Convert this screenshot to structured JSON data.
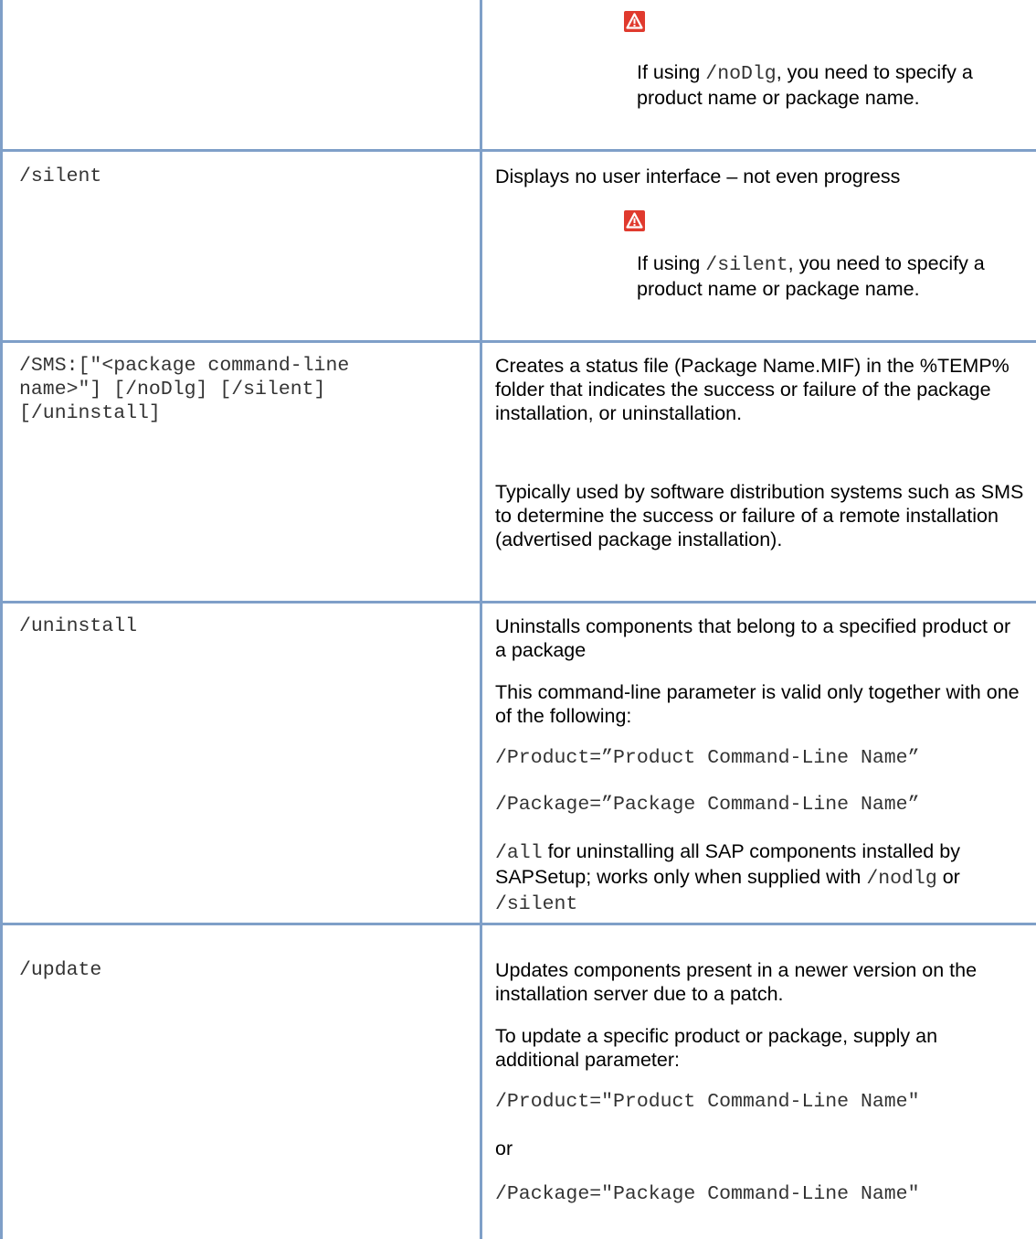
{
  "icons": {
    "warning": "warning-icon",
    "warning_color": "#e03a2e"
  },
  "rows": [
    {
      "param": "",
      "note": {
        "pre": "If using ",
        "code": "/noDlg",
        "post": ", you need to specify a product name or package name."
      }
    },
    {
      "param": "/silent",
      "desc": "Displays no user interface – not even progress",
      "note": {
        "pre": "If using ",
        "code": "/silent",
        "post": ", you need to specify a product name or package name."
      }
    },
    {
      "param_lines": [
        "/SMS:[\"<package command-line",
        "name>\"] [/noDlg] [/silent]",
        "[/uninstall]"
      ],
      "desc1": "Creates a status file (Package Name.MIF) in the %TEMP% folder that indicates the success or failure of the package installation, or uninstallation.",
      "desc2": "Typically used by software distribution systems such as SMS to determine the success or failure of a remote installation (advertised package installation)."
    },
    {
      "param": "/uninstall",
      "desc1": "Uninstalls components that belong to a specified product or a package",
      "desc2": "This command-line parameter is valid only together with one of the following:",
      "code1": "/Product=”Product Command-Line Name”",
      "code2": "/Package=”Package Command-Line Name”",
      "all": {
        "code": "/all",
        "text1": " for uninstalling all SAP components installed by SAPSetup; works only when supplied with ",
        "code2": "/nodlg",
        "or": " or ",
        "code3": "/silent"
      }
    },
    {
      "param": "/update",
      "desc1": "Updates components present in a newer version on the installation server due to a patch.",
      "desc2": "To update a specific product or package, supply an additional parameter:",
      "code1": "/Product=\"Product Command-Line Name\"",
      "or": "or",
      "code2": "/Package=\"Package Command-Line Name\""
    }
  ]
}
